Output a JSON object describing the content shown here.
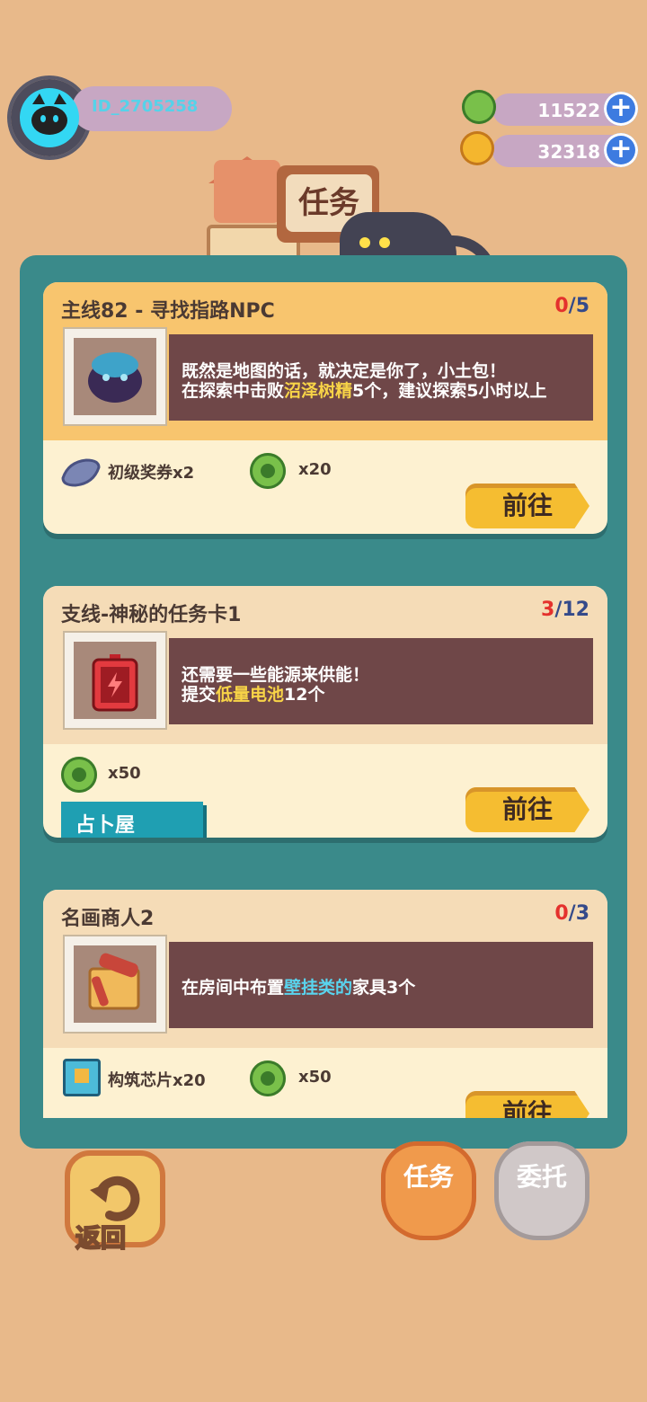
{
  "player": {
    "id": "ID_2705258"
  },
  "currency": [
    {
      "name": "green-coin",
      "value": "11522"
    },
    {
      "name": "gold-coin",
      "value": "32318"
    }
  ],
  "header": {
    "title": "任务"
  },
  "tasks": [
    {
      "title": "主线82 - 寻找指路NPC",
      "progress_current": "0",
      "progress_total": "/5",
      "desc_line1": "既然是地图的话，就决定是你了，小土包！",
      "desc_line2_pre": "在探索中击败",
      "desc_line2_hl": "沼泽树精",
      "desc_line2_post": "5个，建议探索5小时以上",
      "rewards": [
        {
          "icon": "ticket-icon",
          "label": "初级奖券x2"
        },
        {
          "icon": "green-coin-icon",
          "label": "x20"
        }
      ],
      "button": "前往"
    },
    {
      "title": "支线-神秘的任务卡1",
      "progress_current": "3",
      "progress_total": "/12",
      "desc_line1": "还需要一些能源来供能！",
      "desc_line2_pre": "提交",
      "desc_line2_hl": "低量电池",
      "desc_line2_post": "12个",
      "rewards": [
        {
          "icon": "green-coin-icon",
          "label": "x50"
        }
      ],
      "tag": "占卜屋",
      "button": "前往"
    },
    {
      "title": "名画商人2",
      "progress_current": "0",
      "progress_total": "/3",
      "desc_line1_pre": "在房间中布置",
      "desc_line1_hl": "壁挂类的",
      "desc_line1_post": "家具3个",
      "rewards": [
        {
          "icon": "chip-icon",
          "label": "构筑芯片x20"
        },
        {
          "icon": "green-coin-icon",
          "label": "x50"
        }
      ],
      "button": "前往"
    }
  ],
  "bottom": {
    "back_label": "返回",
    "tab_tasks": "任务",
    "tab_commission": "委托"
  },
  "colors": {
    "panel": "#3a8a8a",
    "accent": "#f5bd31",
    "count_current": "#e4312d"
  }
}
